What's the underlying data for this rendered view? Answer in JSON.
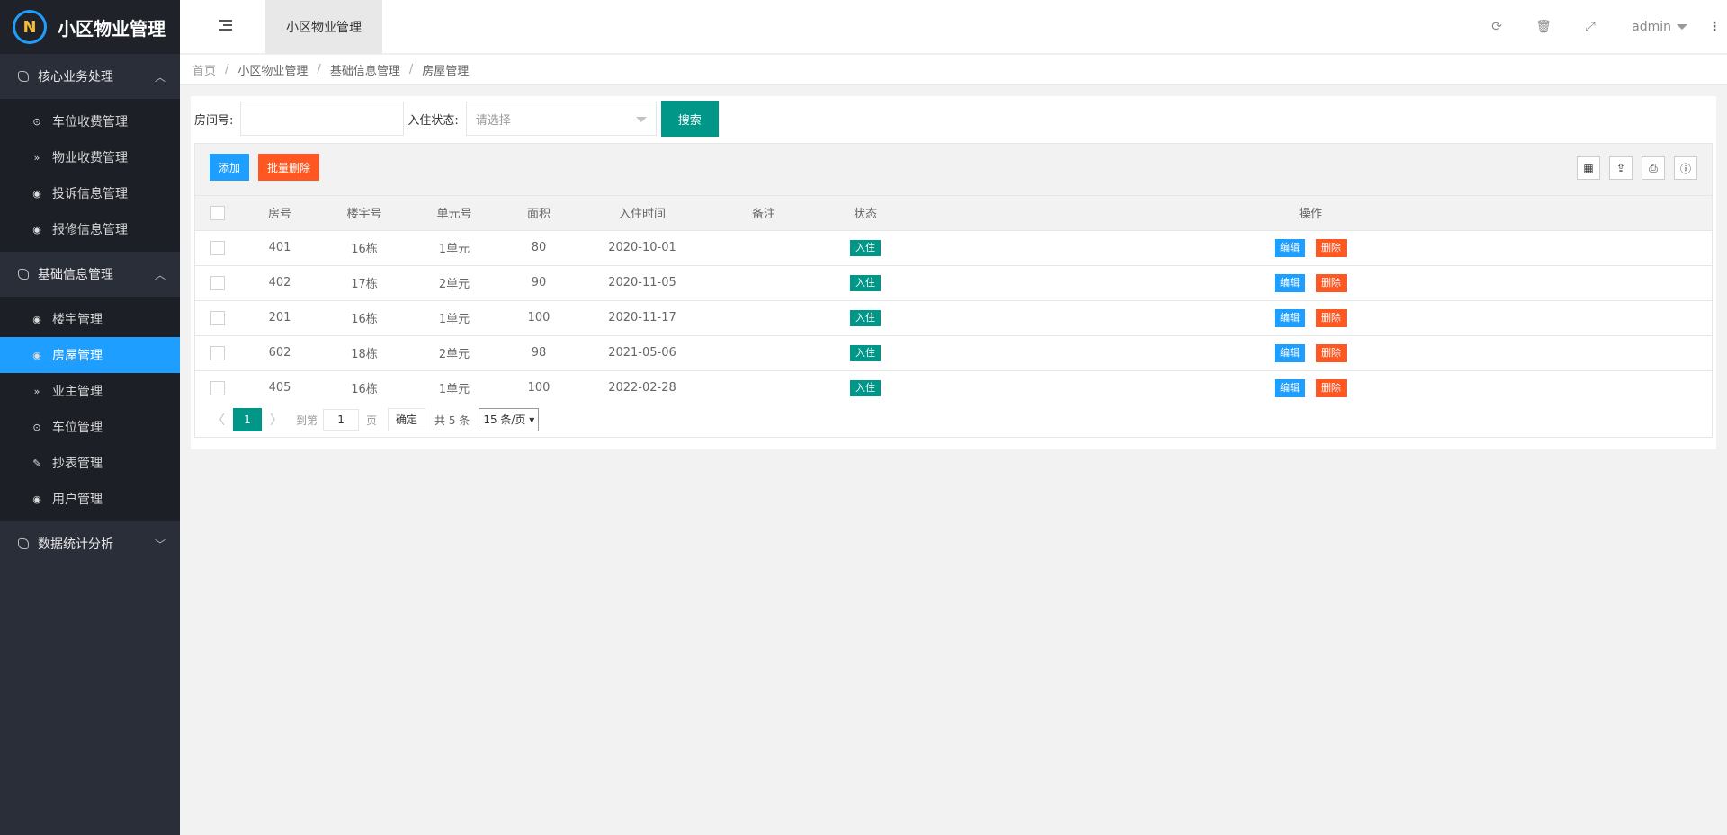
{
  "app": {
    "logo_letter": "N",
    "title": "小区物业管理"
  },
  "sidebar": {
    "groups": [
      {
        "label": "核心业务处理",
        "caret": "︿",
        "items": [
          {
            "label": "车位收费管理",
            "icon": "⊙"
          },
          {
            "label": "物业收费管理",
            "icon": "»"
          },
          {
            "label": "投诉信息管理",
            "icon": "◉"
          },
          {
            "label": "报修信息管理",
            "icon": "◉"
          }
        ]
      },
      {
        "label": "基础信息管理",
        "caret": "︿",
        "items": [
          {
            "label": "楼宇管理",
            "icon": "◉"
          },
          {
            "label": "房屋管理",
            "icon": "◉"
          },
          {
            "label": "业主管理",
            "icon": "»"
          },
          {
            "label": "车位管理",
            "icon": "⊙"
          },
          {
            "label": "抄表管理",
            "icon": "✎"
          },
          {
            "label": "用户管理",
            "icon": "◉"
          }
        ]
      },
      {
        "label": "数据统计分析",
        "caret": "﹀"
      }
    ],
    "active_item": "房屋管理"
  },
  "header": {
    "tab_label": "小区物业管理",
    "icons": {
      "refresh": "⟳",
      "trash": "🗑",
      "fullscreen": "⤢"
    },
    "user": "admin",
    "more": "⋮"
  },
  "breadcrumb": [
    "首页",
    "小区物业管理",
    "基础信息管理",
    "房屋管理"
  ],
  "search": {
    "room_label": "房间号:",
    "room_value": "",
    "status_label": "入住状态:",
    "status_placeholder": "请选择",
    "search_button": "搜索"
  },
  "toolbar": {
    "add": "添加",
    "batch_delete": "批量删除",
    "tools": [
      "▦",
      "⇪",
      "⎙",
      "ⓘ"
    ]
  },
  "table": {
    "columns": [
      "房号",
      "楼宇号",
      "单元号",
      "面积",
      "入住时间",
      "备注",
      "状态",
      "操作"
    ],
    "rows": [
      {
        "room": "401",
        "building": "16栋",
        "unit": "1单元",
        "area": "80",
        "date": "2020-10-01",
        "note": "",
        "status": "入住"
      },
      {
        "room": "402",
        "building": "17栋",
        "unit": "2单元",
        "area": "90",
        "date": "2020-11-05",
        "note": "",
        "status": "入住"
      },
      {
        "room": "201",
        "building": "16栋",
        "unit": "1单元",
        "area": "100",
        "date": "2020-11-17",
        "note": "",
        "status": "入住"
      },
      {
        "room": "602",
        "building": "18栋",
        "unit": "2单元",
        "area": "98",
        "date": "2021-05-06",
        "note": "",
        "status": "入住"
      },
      {
        "room": "405",
        "building": "16栋",
        "unit": "1单元",
        "area": "100",
        "date": "2022-02-28",
        "note": "",
        "status": "入住"
      }
    ],
    "edit_label": "编辑",
    "delete_label": "删除"
  },
  "pager": {
    "prev": "〈",
    "current": "1",
    "next": "〉",
    "goto_label": "到第",
    "goto_value": "1",
    "page_label": "页",
    "ok": "确定",
    "total": "共 5 条",
    "page_size": "15 条/页"
  },
  "colors": {
    "primary": "#009688",
    "blue": "#1e9fff",
    "danger": "#ff5722",
    "sidebar": "#2a2e38"
  }
}
